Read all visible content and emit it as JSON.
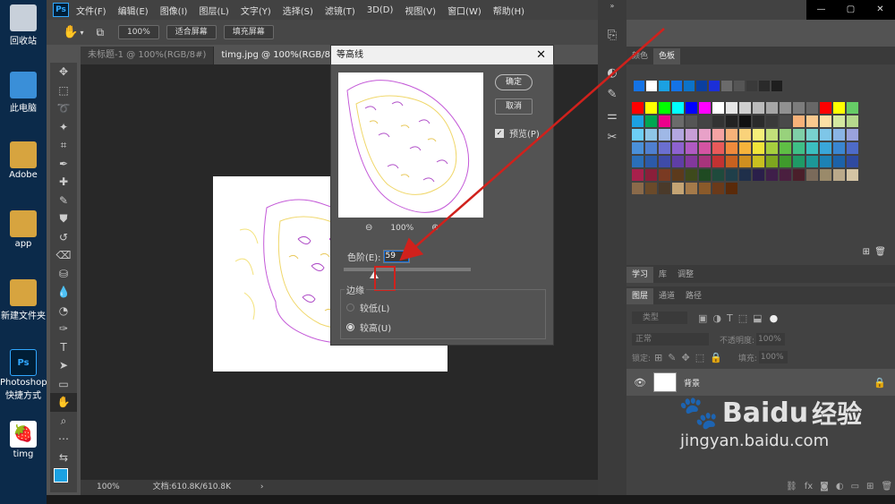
{
  "desktop": {
    "icons": [
      {
        "label": "回收站",
        "icon": "recycle-bin-icon",
        "color": "#c8d0da"
      },
      {
        "label": "此电脑",
        "icon": "computer-icon",
        "color": "#3a8fd8"
      },
      {
        "label": "Adobe",
        "icon": "folder-icon",
        "color": "#d7a43f"
      },
      {
        "label": "app",
        "icon": "folder-icon",
        "color": "#d7a43f"
      },
      {
        "label": "新建文件夹",
        "icon": "folder-icon",
        "color": "#d7a43f"
      },
      {
        "label": "Photoshop 快捷方式",
        "icon": "photoshop-icon",
        "color": "#001e36"
      },
      {
        "label": "timg",
        "icon": "image-file-icon",
        "color": "#ffffff"
      }
    ]
  },
  "menubar": {
    "logo": "Ps",
    "items": [
      "文件(F)",
      "编辑(E)",
      "图像(I)",
      "图层(L)",
      "文字(Y)",
      "选择(S)",
      "滤镜(T)",
      "3D(D)",
      "视图(V)",
      "窗口(W)",
      "帮助(H)"
    ]
  },
  "options": {
    "zoom": "100%",
    "fit_screen": "适合屏幕",
    "fill_screen": "填充屏幕"
  },
  "tabs": [
    {
      "label": "未标题-1 @ 100%(RGB/8#)"
    },
    {
      "label": "timg.jpg @ 100%(RGB/8#)"
    }
  ],
  "status": {
    "zoom": "100%",
    "doc": "文档:610.8K/610.8K"
  },
  "dialog": {
    "title": "等高线",
    "ok": "确定",
    "cancel": "取消",
    "preview_label": "预览(P)",
    "preview_checked": true,
    "zoom": "100%",
    "level_label": "色阶(E):",
    "level_value": "59",
    "slider_fraction": 0.24,
    "edge_label": "边缘",
    "radio_low": "较低(L)",
    "radio_high": "较高(U)",
    "selected": "high"
  },
  "panels": {
    "color_tabs": [
      "颜色",
      "色板"
    ],
    "learn_tabs": [
      "学习",
      "库",
      "调整"
    ],
    "layer_tabs": [
      "图层",
      "通道",
      "路径"
    ],
    "kind_placeholder": "类型",
    "blend_mode": "正常",
    "opacity_label": "不透明度:",
    "opacity_value": "100%",
    "lock_label": "锁定:",
    "fill_label": "填充:",
    "fill_value": "100%",
    "layer_name": "背景"
  },
  "watermark": {
    "brand": "Baidu",
    "brand_cn": "经验",
    "url": "jingyan.baidu.com"
  },
  "colors": {
    "accent": "#1473e6",
    "annotation": "#d0211c"
  }
}
